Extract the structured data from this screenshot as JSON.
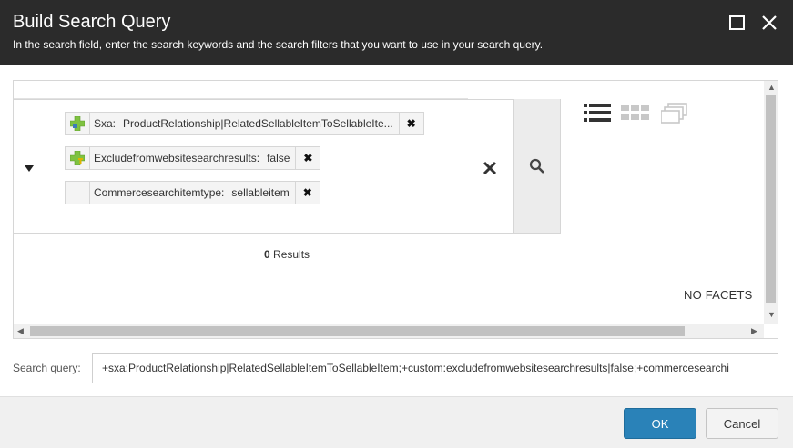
{
  "dialog": {
    "title": "Build Search Query",
    "subtitle": "In the search field, enter the search keywords and the search filters that you want to use in your search query."
  },
  "filters": [
    {
      "key": "Sxa:",
      "value": "ProductRelationship|RelatedSellableItemToSellableIte...",
      "icon": "plus-filter-icon"
    },
    {
      "key": "Excludefromwebsitesearchresults:",
      "value": "false",
      "icon": "plus-filter-icon"
    },
    {
      "key": "Commercesearchitemtype:",
      "value": "sellableitem",
      "icon": ""
    }
  ],
  "results": {
    "count": "0",
    "label": "Results"
  },
  "facets": {
    "empty_label": "NO FACETS"
  },
  "search_query": {
    "label": "Search query:",
    "value": "+sxa:ProductRelationship|RelatedSellableItemToSellableItem;+custom:excludefromwebsitesearchresults|false;+commercesearchi"
  },
  "footer": {
    "ok_label": "OK",
    "cancel_label": "Cancel"
  },
  "colors": {
    "header_bg": "#2b2b2b",
    "ok_bg": "#2a82b8",
    "plus_icon": "#7fc241"
  }
}
